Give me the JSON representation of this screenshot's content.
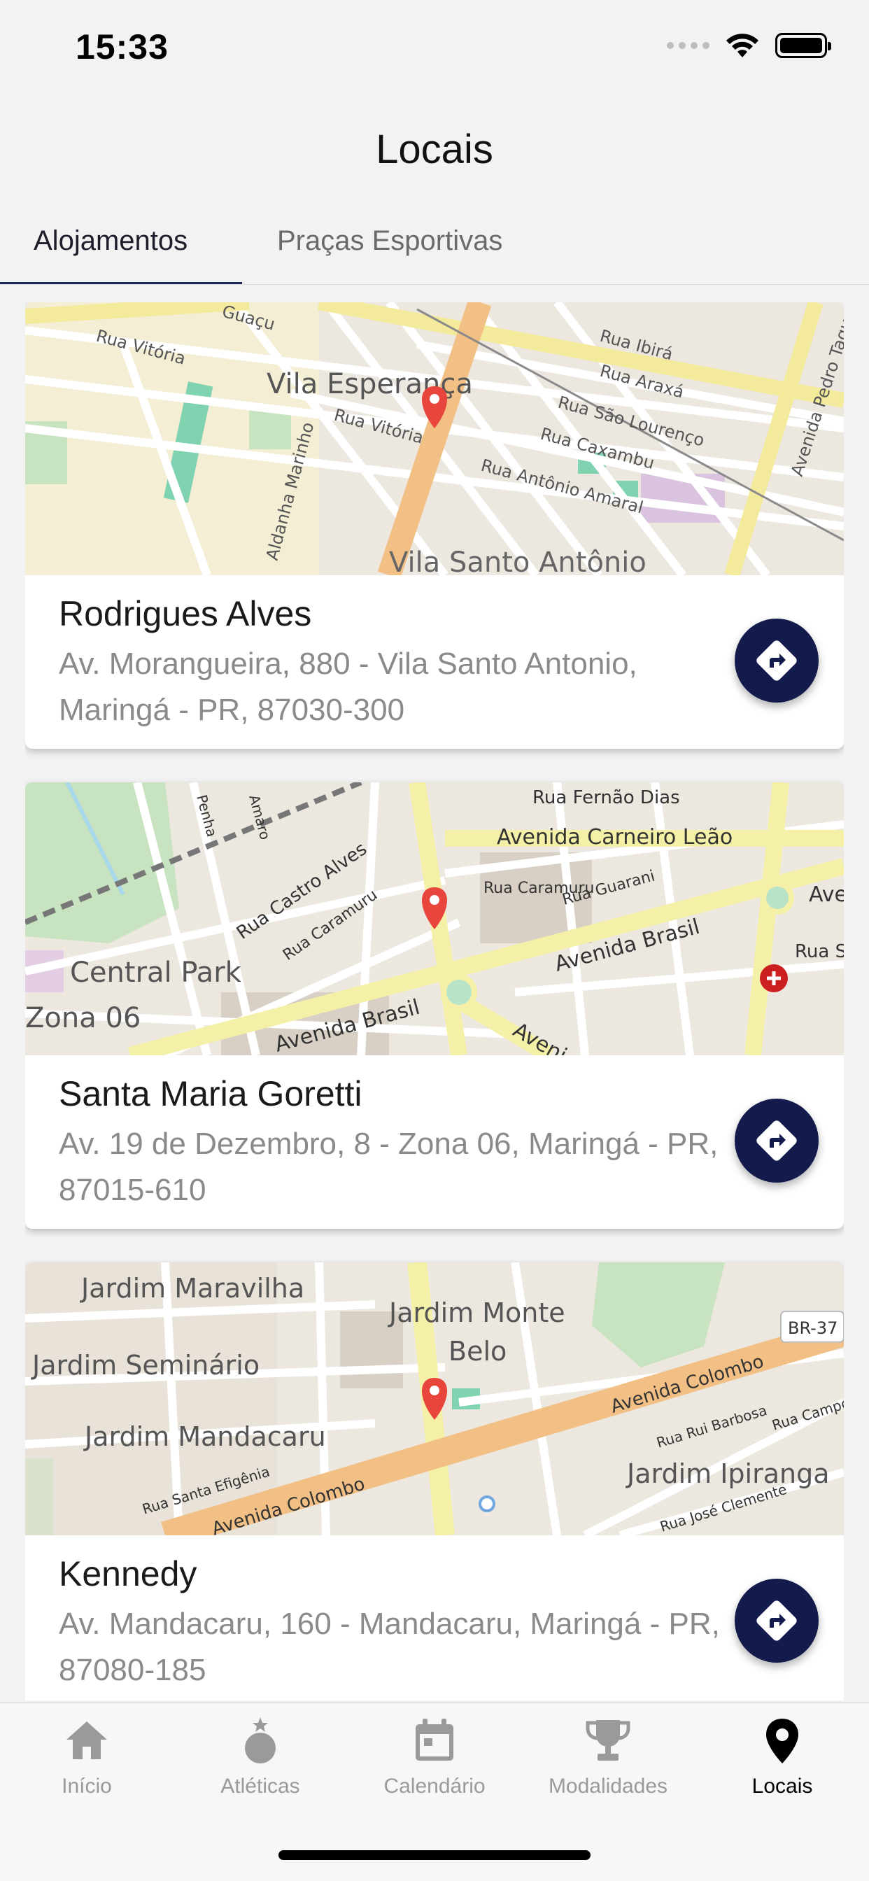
{
  "status_bar": {
    "time": "15:33"
  },
  "header": {
    "title": "Locais"
  },
  "tabs": [
    {
      "label": "Alojamentos",
      "active": true
    },
    {
      "label": "Praças Esportivas",
      "active": false
    }
  ],
  "cards": [
    {
      "name": "Rodrigues Alves",
      "address": "Av. Morangueira, 880 - Vila Santo Antonio, Maringá - PR, 87030-300",
      "map_labels": [
        "Rua Vitória",
        "Vila Esperança",
        "Rua Vitória",
        "Rua Ibirá",
        "Rua Araxá",
        "Rua São Lourenço",
        "Rua Caxambu",
        "Rua Antônio Amaral",
        "Avenida Pedro Taques",
        "Vila Santo Antônio",
        "Guaçu",
        "Aldanha Marinho"
      ]
    },
    {
      "name": "Santa Maria Goretti",
      "address": "Av. 19 de Dezembro, 8 - Zona 06, Maringá - PR, 87015-610",
      "map_labels": [
        "Rua Fernão Dias",
        "Avenida Carneiro Leão",
        "Rua Caramuru",
        "Rua Guarani",
        "Avenida Brasil",
        "Rua Castro Alves",
        "Rua Caramuru",
        "Central Park",
        "Zona 06",
        "Avenida Brasil",
        "Aveni",
        "Ave",
        "Rua San",
        "Amaro",
        "Penha"
      ]
    },
    {
      "name": "Kennedy",
      "address": "Av. Mandacaru, 160 - Mandacaru, Maringá - PR, 87080-185",
      "map_labels": [
        "Jardim Maravilha",
        "Jardim Monte",
        "Belo",
        "Jardim Seminário",
        "Avenida Colombo",
        "Jardim Mandacaru",
        "Rua Rui Barbosa",
        "Rua Campos",
        "Jardim Ipiranga",
        "Rua Santa Efigênia",
        "Avenida Colombo",
        "Rua José Clemente",
        "BR-37"
      ]
    }
  ],
  "bottom_nav": [
    {
      "label": "Início",
      "icon": "home-icon",
      "active": false
    },
    {
      "label": "Atléticas",
      "icon": "medal-icon",
      "active": false
    },
    {
      "label": "Calendário",
      "icon": "calendar-icon",
      "active": false
    },
    {
      "label": "Modalidades",
      "icon": "trophy-icon",
      "active": false
    },
    {
      "label": "Locais",
      "icon": "location-pin-icon",
      "active": true
    }
  ],
  "colors": {
    "accent": "#131b4d",
    "tab_underline": "#1e2a5e",
    "marker": "#e8453c",
    "major_road_orange": "#f2bf84",
    "major_road_yellow": "#f4f0a8",
    "park": "#c8e3c0"
  }
}
